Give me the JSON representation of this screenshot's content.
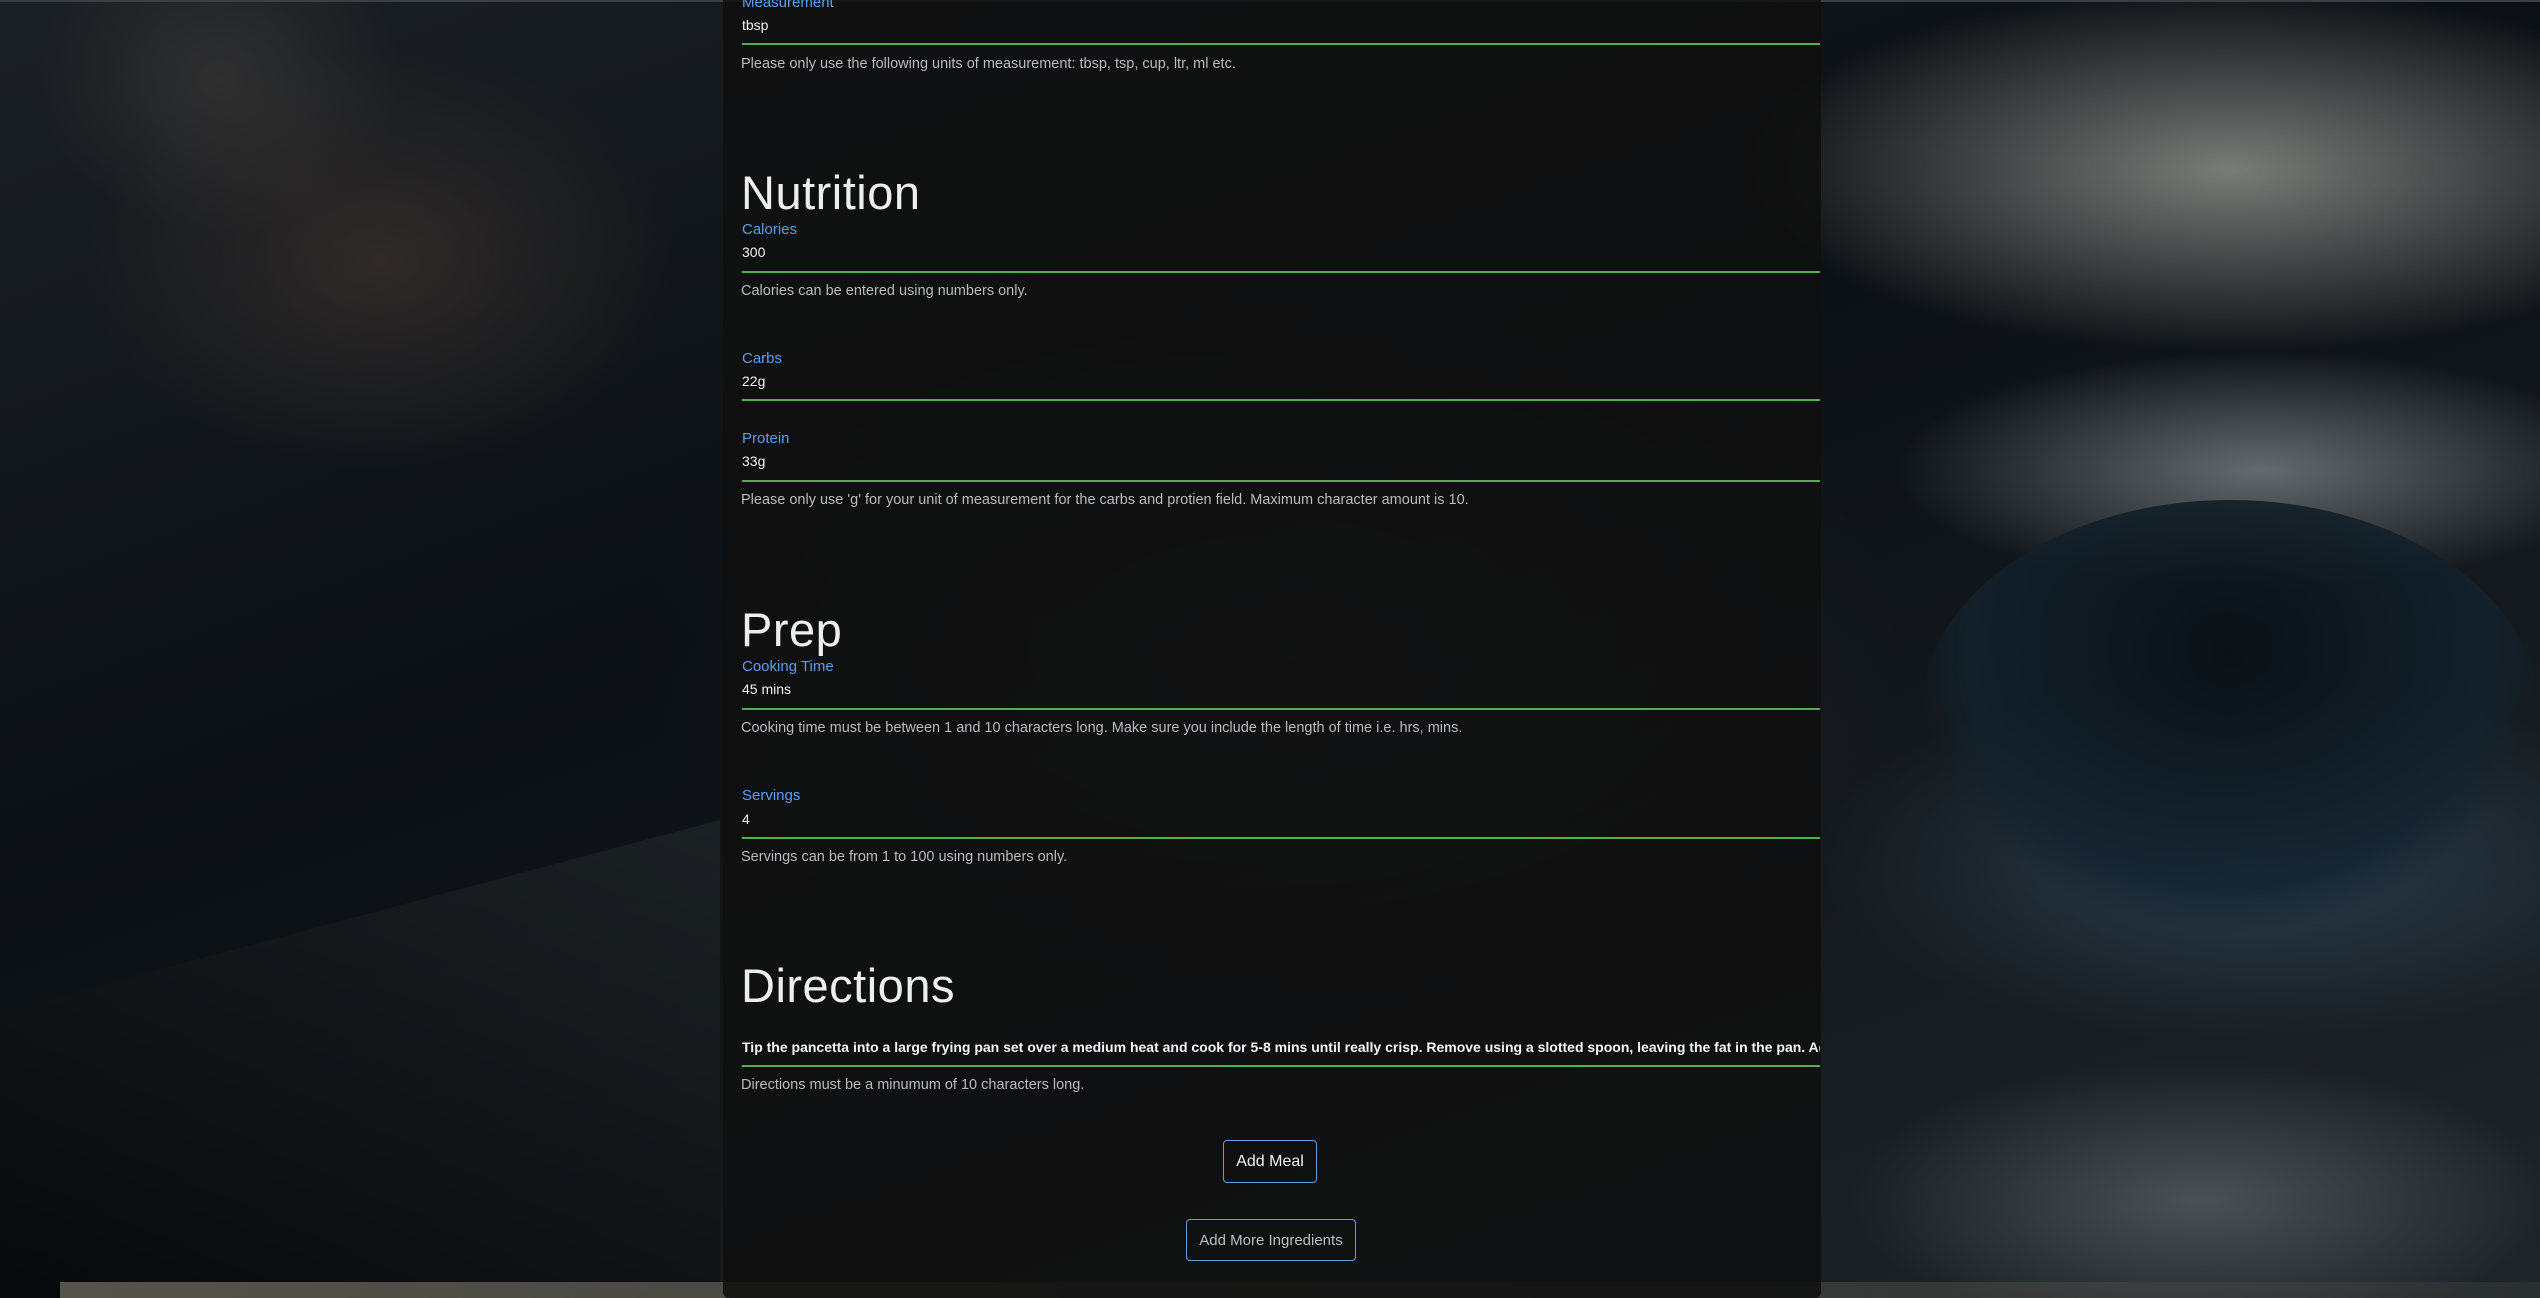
{
  "form": {
    "measurement": {
      "label": "Measurement",
      "value": "tbsp",
      "helper": "Please only use the following units of measurement: tbsp, tsp, cup, ltr, ml etc."
    },
    "nutrition": {
      "title": "Nutrition",
      "calories": {
        "label": "Calories",
        "value": "300",
        "helper": "Calories can be entered using numbers only."
      },
      "carbs": {
        "label": "Carbs",
        "value": "22g"
      },
      "protein": {
        "label": "Protein",
        "value": "33g",
        "helper": "Please only use 'g' for your unit of measurement for the carbs and protien field. Maximum character amount is 10."
      }
    },
    "prep": {
      "title": "Prep",
      "cooking_time": {
        "label": "Cooking Time",
        "value": "45 mins",
        "helper": "Cooking time must be between 1 and 10 characters long. Make sure you include the length of time i.e. hrs, mins."
      },
      "servings": {
        "label": "Servings",
        "value": "4",
        "helper": "Servings can be from 1 to 100 using numbers only."
      }
    },
    "directions": {
      "title": "Directions",
      "value": "Tip the pancetta into a large frying pan set over a medium heat and cook for 5-8 mins until really crisp. Remove using a slotted spoon, leaving the fat in the pan. Add th",
      "helper": "Directions must be a minumum of 10 characters long."
    },
    "buttons": {
      "add_meal": "Add Meal",
      "add_more_ingredients": "Add More Ingredients"
    }
  },
  "colors": {
    "label": "#5b9ef0",
    "underline": "#4fb24a",
    "panel": "#0f0f0f",
    "button_border": "#5b9ef0"
  }
}
